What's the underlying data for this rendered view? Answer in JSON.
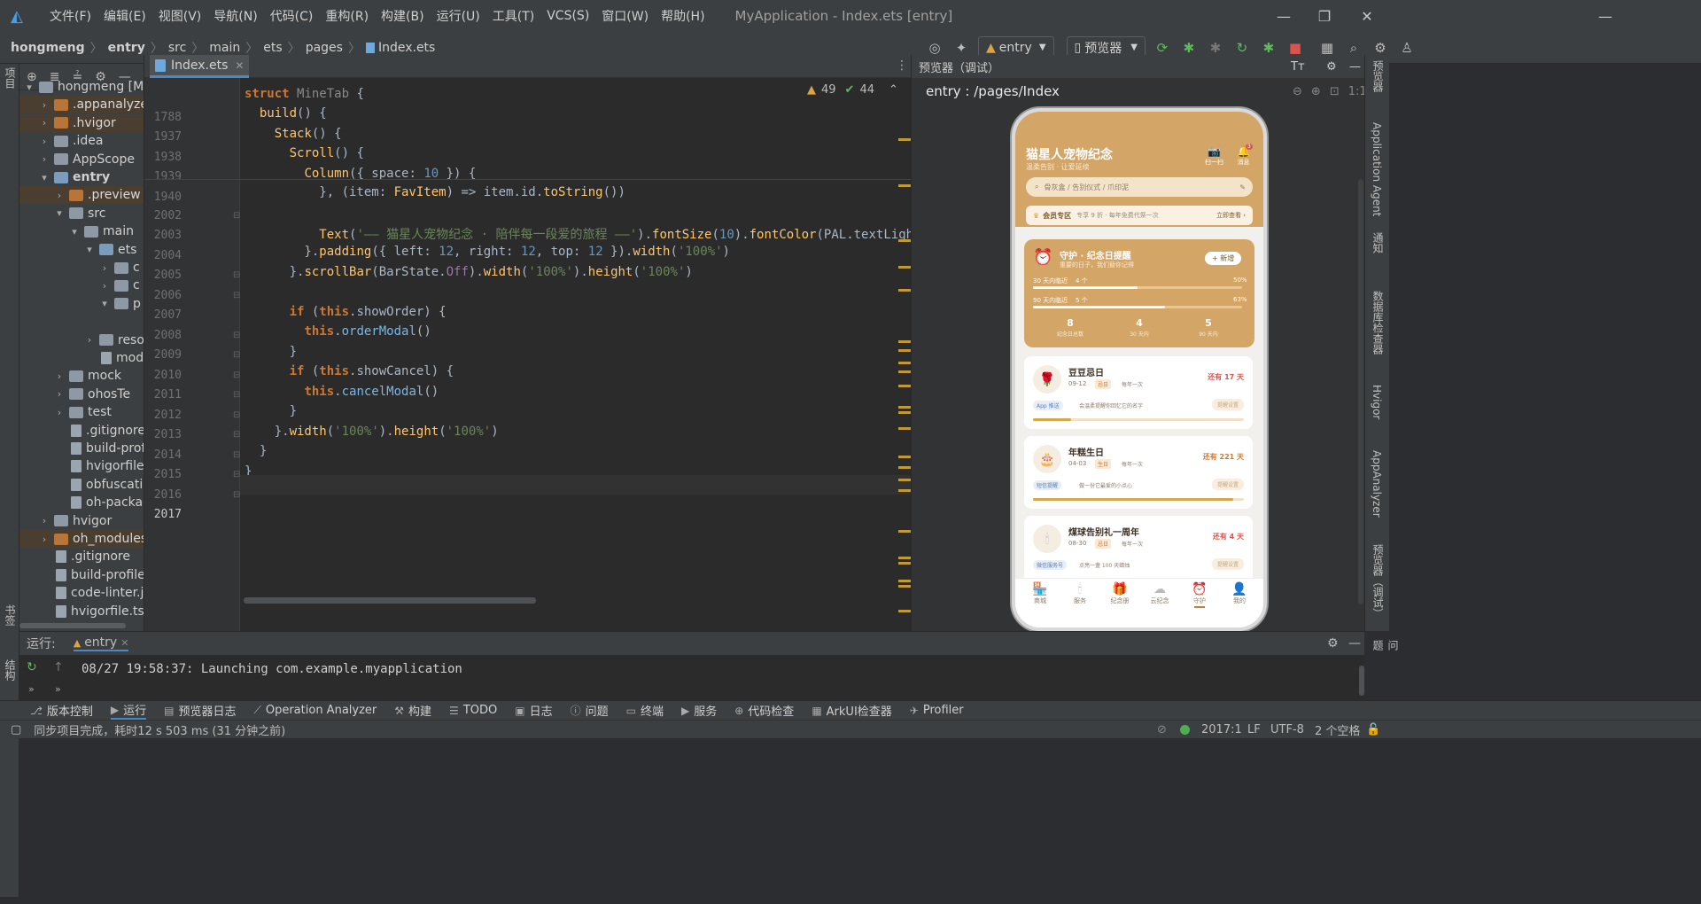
{
  "titlebar": {
    "menus": [
      "文件(F)",
      "编辑(E)",
      "视图(V)",
      "导航(N)",
      "代码(C)",
      "重构(R)",
      "构建(B)",
      "运行(U)",
      "工具(T)",
      "VCS(S)",
      "窗口(W)",
      "帮助(H)"
    ],
    "title": "MyApplication - Index.ets [entry]"
  },
  "navbar": {
    "crumbs": [
      "hongmeng",
      "entry",
      "src",
      "main",
      "ets",
      "pages",
      "Index.ets"
    ],
    "run_config": "entry",
    "device": "预览器"
  },
  "left_strip": {
    "project": "项目",
    "bookmarks": "书签",
    "structure": "结构"
  },
  "project_tree": [
    {
      "label": "hongmeng [My",
      "indent": 0,
      "chev": "▾",
      "icon": "grey"
    },
    {
      "label": ".appanalyzer",
      "indent": 1,
      "chev": "›",
      "icon": "orange"
    },
    {
      "label": ".hvigor",
      "indent": 1,
      "chev": "›",
      "icon": "orange"
    },
    {
      "label": ".idea",
      "indent": 1,
      "chev": "›",
      "icon": "grey"
    },
    {
      "label": "AppScope",
      "indent": 1,
      "chev": "›",
      "icon": "grey"
    },
    {
      "label": "entry",
      "indent": 1,
      "chev": "▾",
      "icon": "blue"
    },
    {
      "label": ".preview",
      "indent": 2,
      "chev": "›",
      "icon": "orange"
    },
    {
      "label": "src",
      "indent": 2,
      "chev": "▾",
      "icon": "grey"
    },
    {
      "label": "main",
      "indent": 3,
      "chev": "▾",
      "icon": "grey"
    },
    {
      "label": "ets",
      "indent": 4,
      "chev": "▾",
      "icon": "blue"
    },
    {
      "label": "c",
      "indent": 5,
      "chev": "›",
      "icon": "grey"
    },
    {
      "label": "c",
      "indent": 5,
      "chev": "›",
      "icon": "grey"
    },
    {
      "label": "p",
      "indent": 5,
      "chev": "▾",
      "icon": "grey"
    },
    {
      "label": "",
      "indent": 6,
      "chev": "",
      "icon": "none"
    },
    {
      "label": "reso",
      "indent": 4,
      "chev": "›",
      "icon": "grey"
    },
    {
      "label": "mod",
      "indent": 4,
      "chev": "",
      "icon": "file"
    },
    {
      "label": "mock",
      "indent": 2,
      "chev": "›",
      "icon": "grey"
    },
    {
      "label": "ohosTe",
      "indent": 2,
      "chev": "›",
      "icon": "grey"
    },
    {
      "label": "test",
      "indent": 2,
      "chev": "›",
      "icon": "grey"
    },
    {
      "label": ".gitignore",
      "indent": 2,
      "chev": "",
      "icon": "file"
    },
    {
      "label": "build-prof",
      "indent": 2,
      "chev": "",
      "icon": "file"
    },
    {
      "label": "hvigorfile.",
      "indent": 2,
      "chev": "",
      "icon": "file"
    },
    {
      "label": "obfuscatio",
      "indent": 2,
      "chev": "",
      "icon": "file"
    },
    {
      "label": "oh-packag",
      "indent": 2,
      "chev": "",
      "icon": "file"
    },
    {
      "label": "hvigor",
      "indent": 1,
      "chev": "›",
      "icon": "grey"
    },
    {
      "label": "oh_modules",
      "indent": 1,
      "chev": "›",
      "icon": "orange"
    },
    {
      "label": ".gitignore",
      "indent": 1,
      "chev": "",
      "icon": "file"
    },
    {
      "label": "build-profile.",
      "indent": 1,
      "chev": "",
      "icon": "file"
    },
    {
      "label": "code-linter.js",
      "indent": 1,
      "chev": "",
      "icon": "file"
    },
    {
      "label": "hvigorfile.ts",
      "indent": 1,
      "chev": "",
      "icon": "file"
    }
  ],
  "editor": {
    "tab": "Index.ets",
    "warnings": "49",
    "checks": "44",
    "lines": [
      {
        "n": "1788",
        "html": "<span class='kw'>struct</span> <span class='ty'>MineTab</span> {"
      },
      {
        "n": "1937",
        "html": "  <span class='fn'>build</span>() {"
      },
      {
        "n": "1938",
        "html": "    <span class='fn'>Stack</span>() {"
      },
      {
        "n": "1939",
        "html": "      <span class='fn'>Scroll</span>() {"
      },
      {
        "n": "1940",
        "html": "        <span class='fn'>Column</span>({ space: <span class='num'>10</span> }) {"
      },
      {
        "n": "2002",
        "html": "          }, (item: <span class='fn'>FavItem</span>) => item.id.<span class='fn'>toString</span>())"
      },
      {
        "n": "2003",
        "html": ""
      },
      {
        "n": "2004",
        "html": "          <span class='fn'>Text</span>(<span class='str'>'—— 猫星人宠物纪念 · 陪伴每一段爱的旅程 ——'</span>).<span class='fn'>fontSize</span>(<span class='num'>10</span>).<span class='fn'>fontColor</span>(PAL.textLight).w"
      },
      {
        "n": "2005",
        "html": "        }.<span class='fn'>padding</span>({ left: <span class='num'>12</span>, right: <span class='num'>12</span>, top: <span class='num'>12</span> }).<span class='fn'>width</span>(<span class='str'>'100%'</span>)"
      },
      {
        "n": "2006",
        "html": "      }.<span class='fn'>scrollBar</span>(BarState.<span class='purple'>Off</span>).<span class='fn'>width</span>(<span class='str'>'100%'</span>).<span class='fn'>height</span>(<span class='str'>'100%'</span>)"
      },
      {
        "n": "2007",
        "html": ""
      },
      {
        "n": "2008",
        "html": "      <span class='kw'>if</span> (<span class='kw'>this</span>.showOrder) {"
      },
      {
        "n": "2009",
        "html": "        <span class='kw'>this</span>.<span class='call'>orderModal</span>()"
      },
      {
        "n": "2010",
        "html": "      }"
      },
      {
        "n": "2011",
        "html": "      <span class='kw'>if</span> (<span class='kw'>this</span>.showCancel) {"
      },
      {
        "n": "2012",
        "html": "        <span class='kw'>this</span>.<span class='call'>cancelModal</span>()"
      },
      {
        "n": "2013",
        "html": "      }"
      },
      {
        "n": "2014",
        "html": "    }.<span class='fn'>width</span>(<span class='str'>'100%'</span>).<span class='fn'>height</span>(<span class='str'>'100%'</span>)"
      },
      {
        "n": "2015",
        "html": "  }"
      },
      {
        "n": "2016",
        "html": "}"
      },
      {
        "n": "2017",
        "html": ""
      }
    ]
  },
  "preview": {
    "header": "预览器（调试）",
    "route": "entry : /pages/Index",
    "app": {
      "title": "猫星人宠物纪念",
      "subtitle": "温柔告别 · 让爱延续",
      "scan_label": "扫一扫",
      "msg_label": "消息",
      "msg_badge": "3",
      "search_placeholder": "骨灰盒 / 告别仪式 / 爪印泥",
      "vip_label": "会员专区",
      "vip_desc": "专享 9 折 · 每年免费代祭一次",
      "vip_link": "立即查看 ›",
      "guard_title": "守护 · 纪念日提醒",
      "guard_sub": "重要的日子，我们替你记得",
      "add_btn": "+ 新增",
      "progress": [
        {
          "label": "30 天内临近",
          "count": "4 个",
          "pct": "50%",
          "fill": 0.5
        },
        {
          "label": "90 天内临近",
          "count": "5 个",
          "pct": "63%",
          "fill": 0.63
        }
      ],
      "stats": [
        {
          "value": "8",
          "label": "纪念日总数"
        },
        {
          "value": "4",
          "label": "30 天内"
        },
        {
          "value": "5",
          "label": "90 天内"
        }
      ],
      "memorials": [
        {
          "emoji": "🌹",
          "name": "豆豆忌日",
          "date": "09-12",
          "tag": "忌日",
          "freq": "每年一次",
          "remain": "还有 17 天",
          "remind_tag": "App 推送",
          "remind_text": "会温柔提醒你回忆它的名字",
          "action": "提醒设置",
          "fill": 0.18,
          "color": "#d6a64b"
        },
        {
          "emoji": "🎂",
          "name": "年糕生日",
          "date": "04-03",
          "tag": "生日",
          "freq": "每年一次",
          "remain": "还有 221 天",
          "remind_tag": "短信提醒",
          "remind_text": "做一份它最爱的小点心",
          "action": "提醒设置",
          "fill": 0.95,
          "color": "#d6a64b"
        },
        {
          "emoji": "🕯",
          "name": "煤球告别礼一周年",
          "date": "08-30",
          "tag": "忌日",
          "freq": "每年一次",
          "remain": "还有 4 天",
          "remind_tag": "微信服务号",
          "remind_text": "点亮一盏 100 天蜡烛",
          "action": "提醒设置",
          "fill": 0.04,
          "color": "#e0554a"
        }
      ],
      "tabs": [
        {
          "icon": "🏪",
          "label": "商城"
        },
        {
          "icon": "🕯",
          "label": "服务"
        },
        {
          "icon": "🎁",
          "label": "纪念册"
        },
        {
          "icon": "☁",
          "label": "云纪念"
        },
        {
          "icon": "⏰",
          "label": "守护"
        },
        {
          "icon": "👤",
          "label": "我的"
        }
      ]
    }
  },
  "right_strip": [
    "预览器",
    "Application Agent",
    "通知",
    "数据库检查器",
    "Hvigor",
    "AppAnalyzer",
    "预览器（调试）",
    "问题"
  ],
  "run": {
    "label": "运行:",
    "tab": "entry",
    "log": "08/27 19:58:37: Launching com.example.myapplication"
  },
  "bottom_tools": [
    "版本控制",
    "运行",
    "预览器日志",
    "Operation Analyzer",
    "构建",
    "TODO",
    "日志",
    "问题",
    "终端",
    "服务",
    "代码检查",
    "ArkUI检查器",
    "Profiler"
  ],
  "status": {
    "message": "同步项目完成，耗时12 s 503 ms (31 分钟之前)",
    "position": "2017:1",
    "line_sep": "LF",
    "encoding": "UTF-8",
    "indent": "2 个空格"
  }
}
